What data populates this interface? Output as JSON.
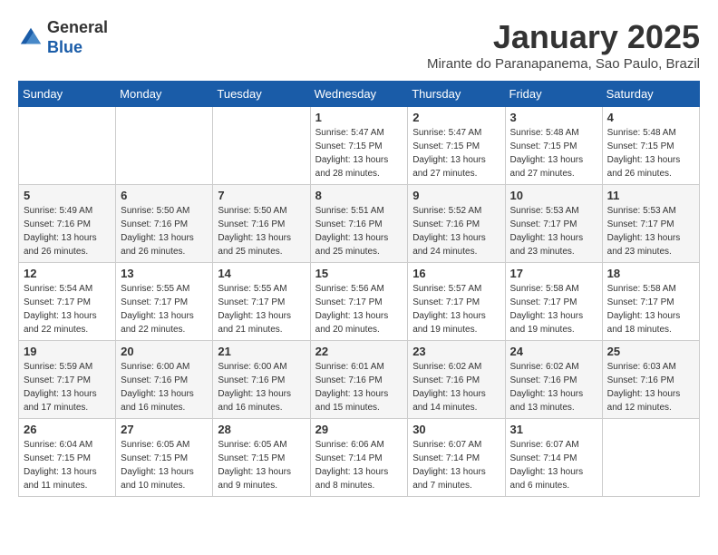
{
  "header": {
    "logo_line1": "General",
    "logo_line2": "Blue",
    "month_title": "January 2025",
    "subtitle": "Mirante do Paranapanema, Sao Paulo, Brazil"
  },
  "days_of_week": [
    "Sunday",
    "Monday",
    "Tuesday",
    "Wednesday",
    "Thursday",
    "Friday",
    "Saturday"
  ],
  "weeks": [
    [
      {
        "day": "",
        "sunrise": "",
        "sunset": "",
        "daylight": ""
      },
      {
        "day": "",
        "sunrise": "",
        "sunset": "",
        "daylight": ""
      },
      {
        "day": "",
        "sunrise": "",
        "sunset": "",
        "daylight": ""
      },
      {
        "day": "1",
        "sunrise": "Sunrise: 5:47 AM",
        "sunset": "Sunset: 7:15 PM",
        "daylight": "Daylight: 13 hours and 28 minutes."
      },
      {
        "day": "2",
        "sunrise": "Sunrise: 5:47 AM",
        "sunset": "Sunset: 7:15 PM",
        "daylight": "Daylight: 13 hours and 27 minutes."
      },
      {
        "day": "3",
        "sunrise": "Sunrise: 5:48 AM",
        "sunset": "Sunset: 7:15 PM",
        "daylight": "Daylight: 13 hours and 27 minutes."
      },
      {
        "day": "4",
        "sunrise": "Sunrise: 5:48 AM",
        "sunset": "Sunset: 7:15 PM",
        "daylight": "Daylight: 13 hours and 26 minutes."
      }
    ],
    [
      {
        "day": "5",
        "sunrise": "Sunrise: 5:49 AM",
        "sunset": "Sunset: 7:16 PM",
        "daylight": "Daylight: 13 hours and 26 minutes."
      },
      {
        "day": "6",
        "sunrise": "Sunrise: 5:50 AM",
        "sunset": "Sunset: 7:16 PM",
        "daylight": "Daylight: 13 hours and 26 minutes."
      },
      {
        "day": "7",
        "sunrise": "Sunrise: 5:50 AM",
        "sunset": "Sunset: 7:16 PM",
        "daylight": "Daylight: 13 hours and 25 minutes."
      },
      {
        "day": "8",
        "sunrise": "Sunrise: 5:51 AM",
        "sunset": "Sunset: 7:16 PM",
        "daylight": "Daylight: 13 hours and 25 minutes."
      },
      {
        "day": "9",
        "sunrise": "Sunrise: 5:52 AM",
        "sunset": "Sunset: 7:16 PM",
        "daylight": "Daylight: 13 hours and 24 minutes."
      },
      {
        "day": "10",
        "sunrise": "Sunrise: 5:53 AM",
        "sunset": "Sunset: 7:17 PM",
        "daylight": "Daylight: 13 hours and 23 minutes."
      },
      {
        "day": "11",
        "sunrise": "Sunrise: 5:53 AM",
        "sunset": "Sunset: 7:17 PM",
        "daylight": "Daylight: 13 hours and 23 minutes."
      }
    ],
    [
      {
        "day": "12",
        "sunrise": "Sunrise: 5:54 AM",
        "sunset": "Sunset: 7:17 PM",
        "daylight": "Daylight: 13 hours and 22 minutes."
      },
      {
        "day": "13",
        "sunrise": "Sunrise: 5:55 AM",
        "sunset": "Sunset: 7:17 PM",
        "daylight": "Daylight: 13 hours and 22 minutes."
      },
      {
        "day": "14",
        "sunrise": "Sunrise: 5:55 AM",
        "sunset": "Sunset: 7:17 PM",
        "daylight": "Daylight: 13 hours and 21 minutes."
      },
      {
        "day": "15",
        "sunrise": "Sunrise: 5:56 AM",
        "sunset": "Sunset: 7:17 PM",
        "daylight": "Daylight: 13 hours and 20 minutes."
      },
      {
        "day": "16",
        "sunrise": "Sunrise: 5:57 AM",
        "sunset": "Sunset: 7:17 PM",
        "daylight": "Daylight: 13 hours and 19 minutes."
      },
      {
        "day": "17",
        "sunrise": "Sunrise: 5:58 AM",
        "sunset": "Sunset: 7:17 PM",
        "daylight": "Daylight: 13 hours and 19 minutes."
      },
      {
        "day": "18",
        "sunrise": "Sunrise: 5:58 AM",
        "sunset": "Sunset: 7:17 PM",
        "daylight": "Daylight: 13 hours and 18 minutes."
      }
    ],
    [
      {
        "day": "19",
        "sunrise": "Sunrise: 5:59 AM",
        "sunset": "Sunset: 7:17 PM",
        "daylight": "Daylight: 13 hours and 17 minutes."
      },
      {
        "day": "20",
        "sunrise": "Sunrise: 6:00 AM",
        "sunset": "Sunset: 7:16 PM",
        "daylight": "Daylight: 13 hours and 16 minutes."
      },
      {
        "day": "21",
        "sunrise": "Sunrise: 6:00 AM",
        "sunset": "Sunset: 7:16 PM",
        "daylight": "Daylight: 13 hours and 16 minutes."
      },
      {
        "day": "22",
        "sunrise": "Sunrise: 6:01 AM",
        "sunset": "Sunset: 7:16 PM",
        "daylight": "Daylight: 13 hours and 15 minutes."
      },
      {
        "day": "23",
        "sunrise": "Sunrise: 6:02 AM",
        "sunset": "Sunset: 7:16 PM",
        "daylight": "Daylight: 13 hours and 14 minutes."
      },
      {
        "day": "24",
        "sunrise": "Sunrise: 6:02 AM",
        "sunset": "Sunset: 7:16 PM",
        "daylight": "Daylight: 13 hours and 13 minutes."
      },
      {
        "day": "25",
        "sunrise": "Sunrise: 6:03 AM",
        "sunset": "Sunset: 7:16 PM",
        "daylight": "Daylight: 13 hours and 12 minutes."
      }
    ],
    [
      {
        "day": "26",
        "sunrise": "Sunrise: 6:04 AM",
        "sunset": "Sunset: 7:15 PM",
        "daylight": "Daylight: 13 hours and 11 minutes."
      },
      {
        "day": "27",
        "sunrise": "Sunrise: 6:05 AM",
        "sunset": "Sunset: 7:15 PM",
        "daylight": "Daylight: 13 hours and 10 minutes."
      },
      {
        "day": "28",
        "sunrise": "Sunrise: 6:05 AM",
        "sunset": "Sunset: 7:15 PM",
        "daylight": "Daylight: 13 hours and 9 minutes."
      },
      {
        "day": "29",
        "sunrise": "Sunrise: 6:06 AM",
        "sunset": "Sunset: 7:14 PM",
        "daylight": "Daylight: 13 hours and 8 minutes."
      },
      {
        "day": "30",
        "sunrise": "Sunrise: 6:07 AM",
        "sunset": "Sunset: 7:14 PM",
        "daylight": "Daylight: 13 hours and 7 minutes."
      },
      {
        "day": "31",
        "sunrise": "Sunrise: 6:07 AM",
        "sunset": "Sunset: 7:14 PM",
        "daylight": "Daylight: 13 hours and 6 minutes."
      },
      {
        "day": "",
        "sunrise": "",
        "sunset": "",
        "daylight": ""
      }
    ]
  ]
}
